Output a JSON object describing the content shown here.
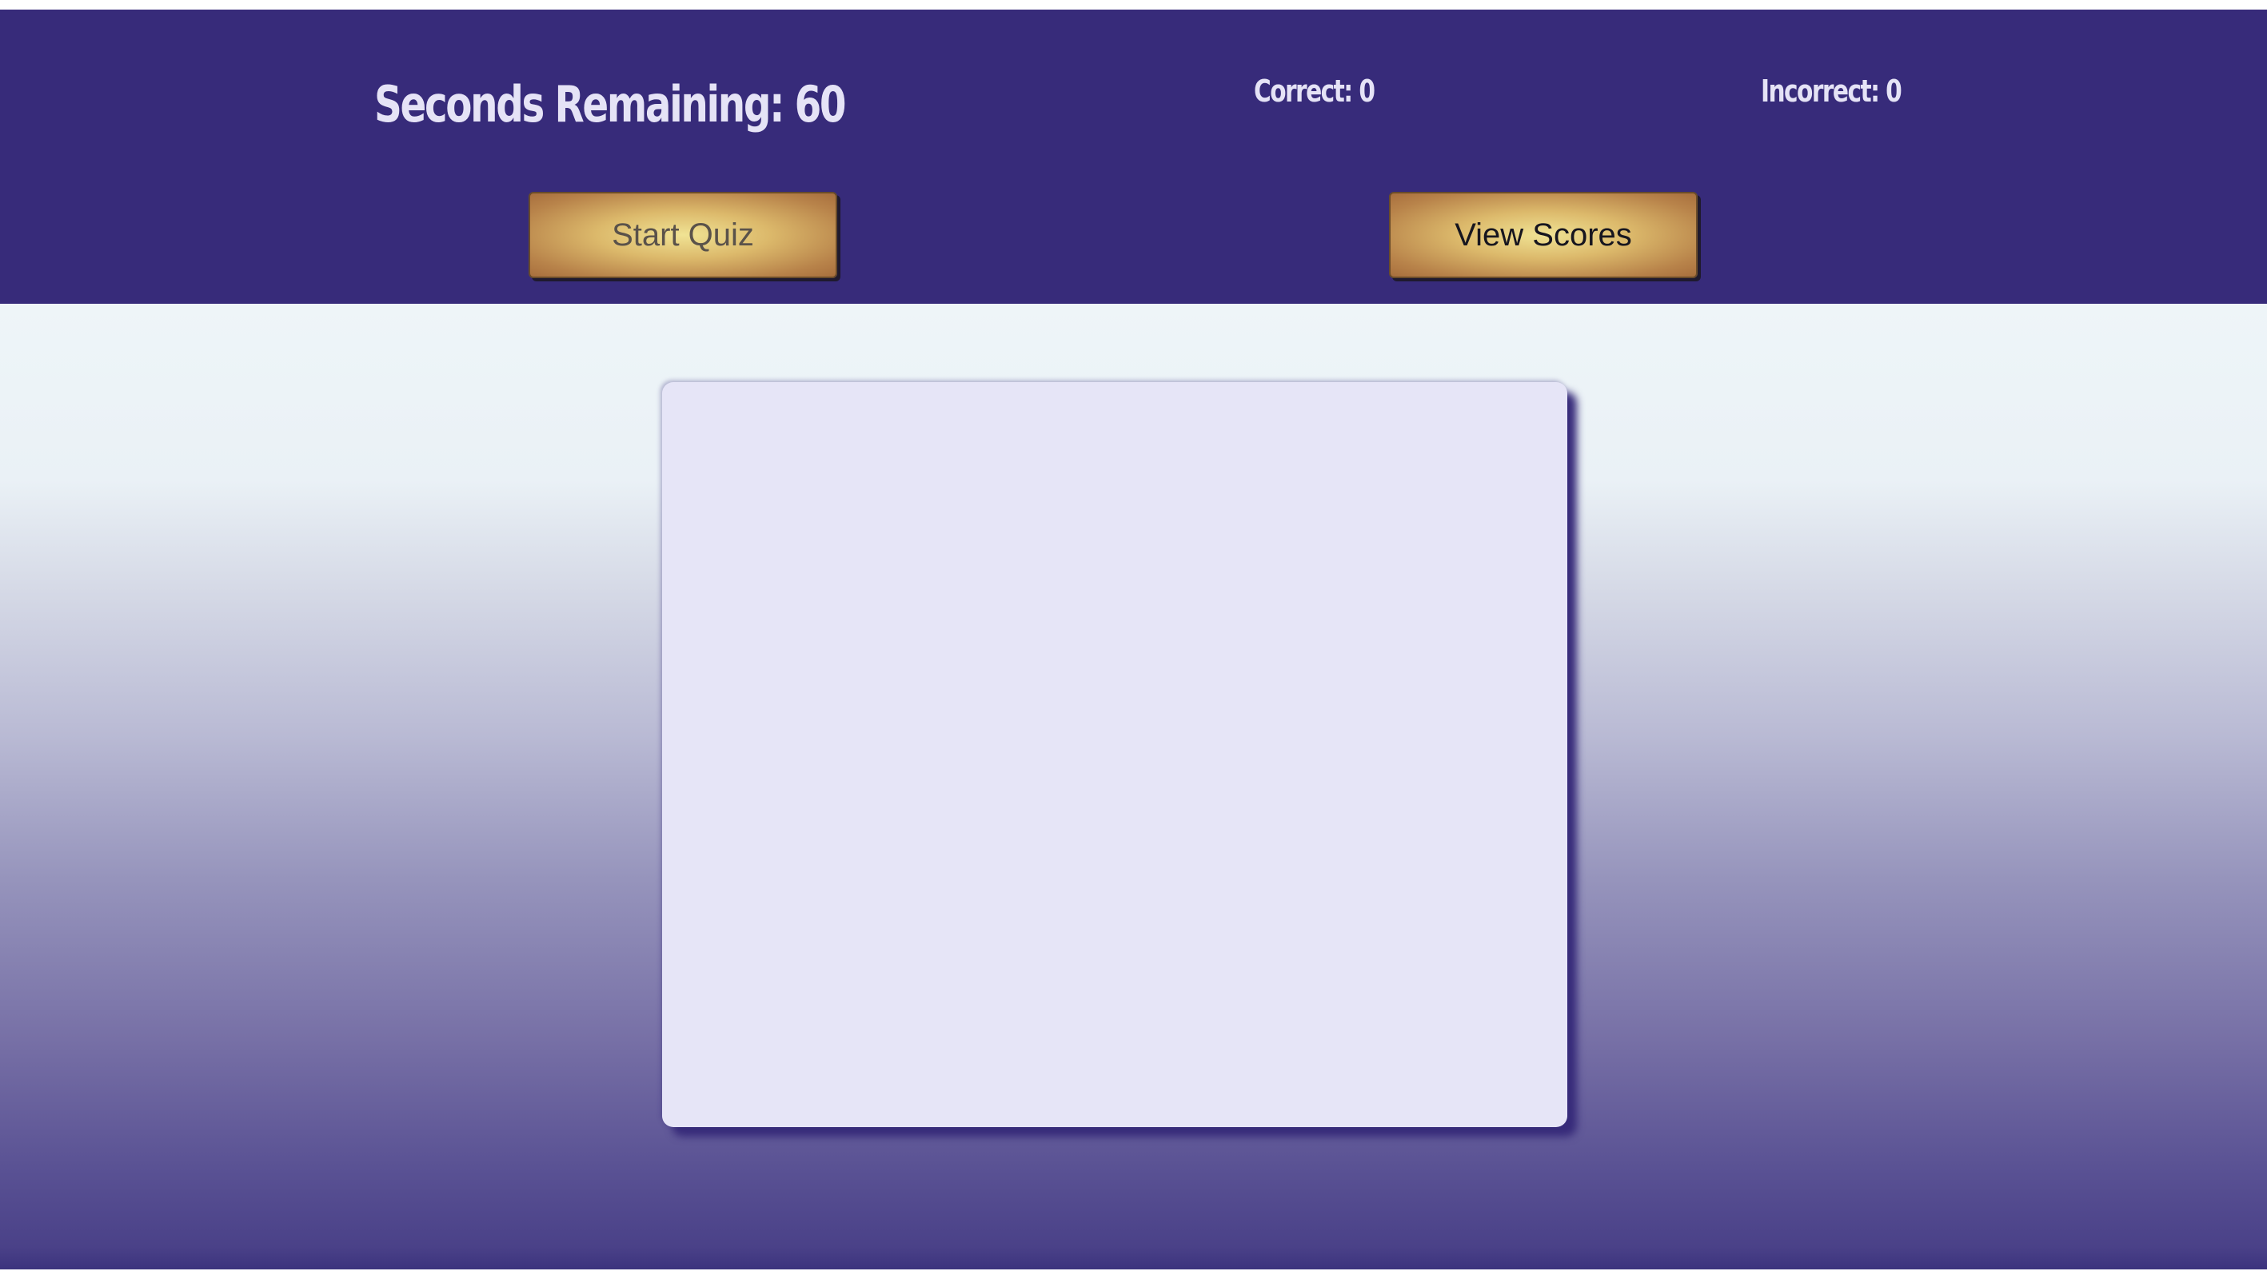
{
  "header": {
    "timer_label": "Seconds Remaining: 60",
    "correct_label": "Correct: 0",
    "incorrect_label": "Incorrect: 0",
    "start_button": "Start Quiz",
    "view_scores_button": "View Scores"
  },
  "colors": {
    "header_background": "#372b7a",
    "header_text": "#e5e3f6",
    "button_gold": "#f0e394",
    "button_bronze": "#a86f3d",
    "card_background": "#e6e5f7"
  }
}
